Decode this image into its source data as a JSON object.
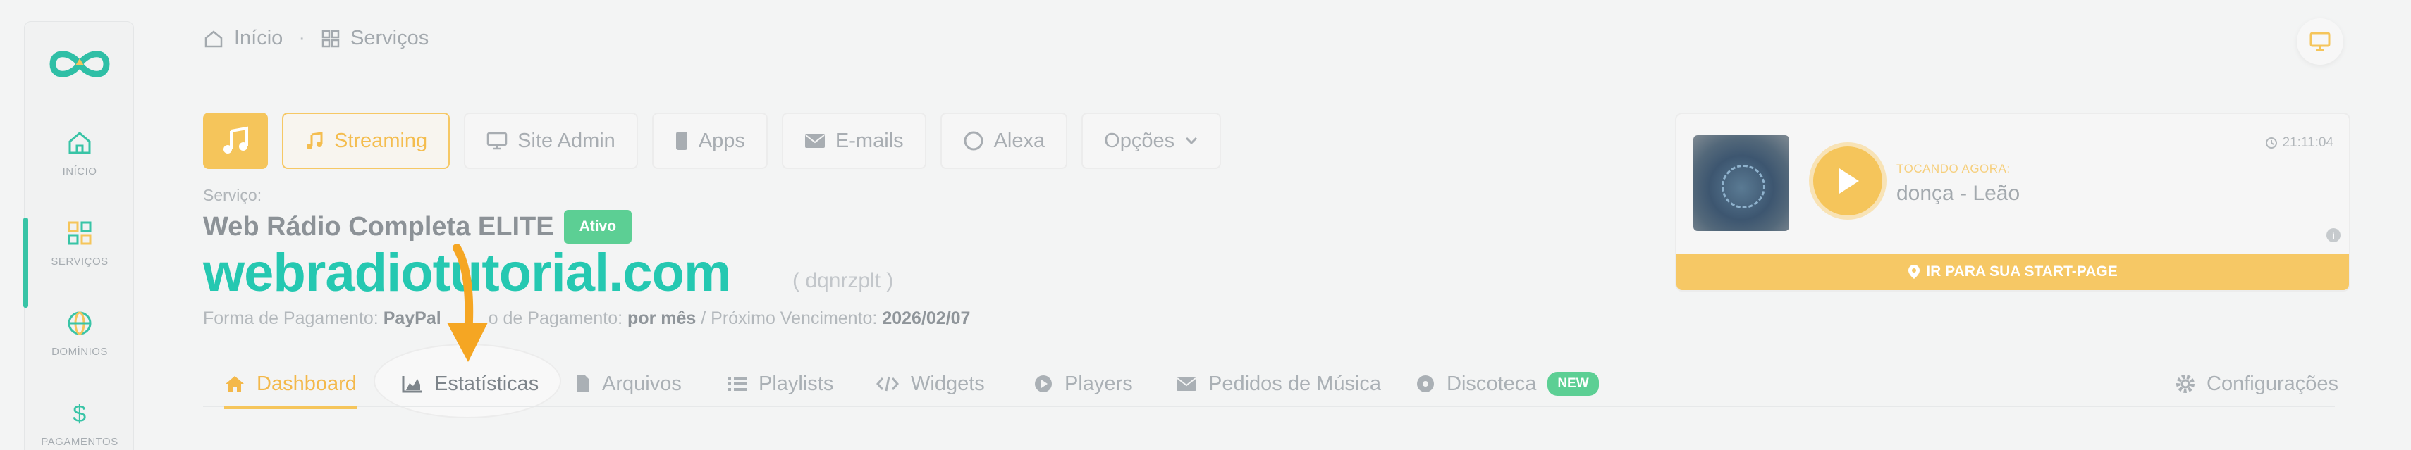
{
  "sidebar": {
    "items": [
      {
        "label": "INÍCIO",
        "icon": "home-icon"
      },
      {
        "label": "SERVIÇOS",
        "icon": "grid-icon"
      },
      {
        "label": "DOMÍNIOS",
        "icon": "globe-icon"
      },
      {
        "label": "PAGAMENTOS",
        "icon": "dollar-icon"
      }
    ],
    "active": "SERVIÇOS"
  },
  "breadcrumb": {
    "home": "Início",
    "separator": "·",
    "current": "Serviços"
  },
  "topbar": {
    "buttons": [
      {
        "label": "Streaming",
        "icon": "music-note-icon",
        "active": true
      },
      {
        "label": "Site Admin",
        "icon": "monitor-icon"
      },
      {
        "label": "Apps",
        "icon": "phone-icon"
      },
      {
        "label": "E-mails",
        "icon": "envelope-icon"
      },
      {
        "label": "Alexa",
        "icon": "alexa-ring-icon"
      },
      {
        "label": "Opções",
        "icon": "chevron-down-icon"
      }
    ]
  },
  "service": {
    "label": "Serviço:",
    "name": "Web Rádio Completa ELITE",
    "status": "Ativo",
    "domain": "webradiotutorial.com",
    "domain_id": "( dqnrzplt )",
    "payment_label": "Forma de Pagamento:",
    "payment_value": "PayPal",
    "cycle_label": "o de Pagamento:",
    "cycle_value": "por mês",
    "due_label": "/ Próximo Vencimento:",
    "due_value": "2026/02/07"
  },
  "tabs": [
    {
      "label": "Dashboard",
      "icon": "home-icon",
      "active": true
    },
    {
      "label": "Estatísticas",
      "icon": "area-chart-icon"
    },
    {
      "label": "Arquivos",
      "icon": "file-icon"
    },
    {
      "label": "Playlists",
      "icon": "list-icon"
    },
    {
      "label": "Widgets",
      "icon": "code-icon"
    },
    {
      "label": "Players",
      "icon": "play-circle-icon"
    },
    {
      "label": "Pedidos de Música",
      "icon": "envelope-icon"
    },
    {
      "label": "Discoteca",
      "icon": "disc-icon",
      "badge": "NEW"
    },
    {
      "label": "Configurações",
      "icon": "gear-icon"
    }
  ],
  "player": {
    "now_label": "TOCANDO AGORA:",
    "track": "donça - Leão",
    "time": "21:11:04",
    "start_page": "IR PARA SUA START-PAGE"
  },
  "colors": {
    "accent_yellow": "#f5c55b",
    "brand_teal": "#25c8b1",
    "status_green": "#5ccf94",
    "arrow_orange": "#f5a623"
  }
}
